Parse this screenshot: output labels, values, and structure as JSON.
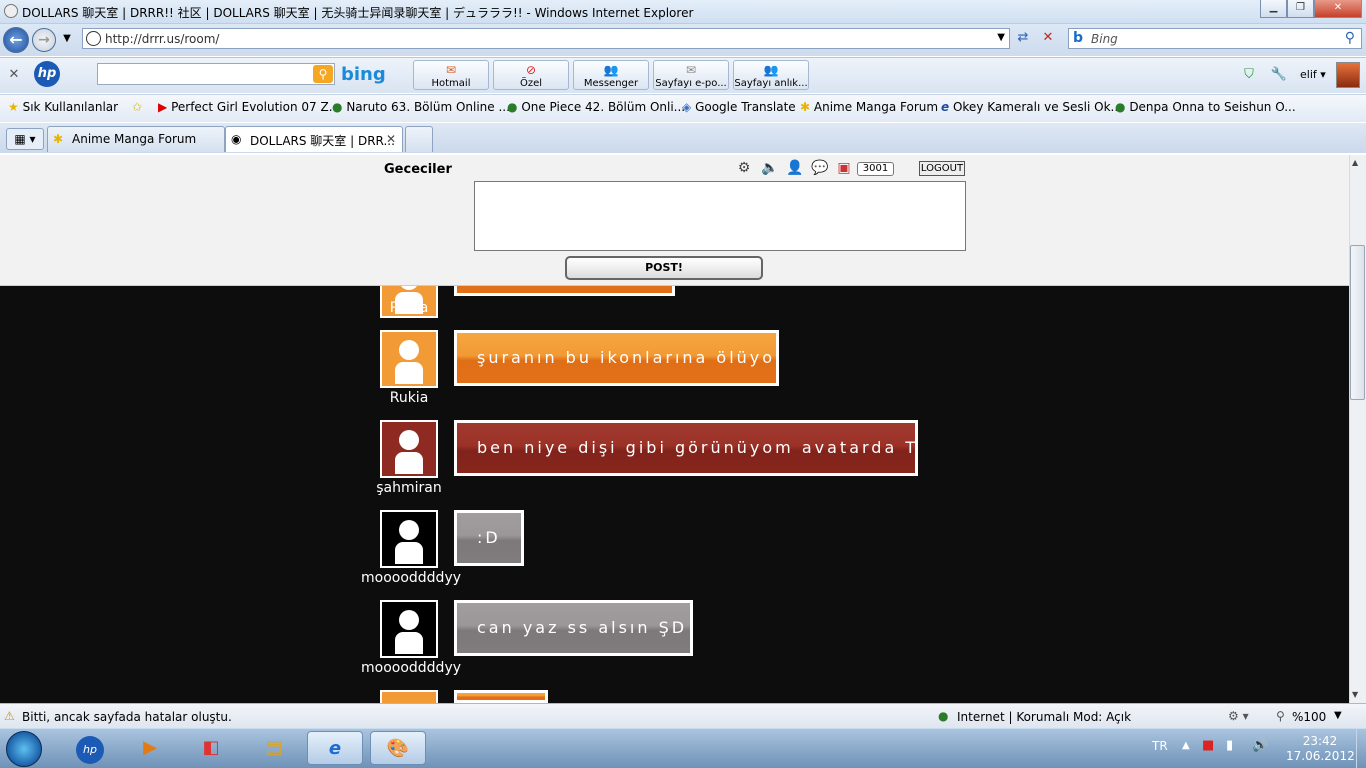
{
  "window": {
    "title": "DOLLARS 聊天室 | DRRR!! 社区 | DOLLARS 聊天室 | 无头骑士异闻录聊天室 | デュラララ!! - Windows Internet Explorer"
  },
  "address": {
    "url": "http://drrr.us/room/"
  },
  "search": {
    "placeholder": "Bing"
  },
  "hp_toolbar": {
    "bing_logo": "bing",
    "buttons": [
      {
        "label": "Hotmail",
        "glyph": "✉"
      },
      {
        "label": "Özel",
        "glyph": "⊘"
      },
      {
        "label": "Messenger",
        "glyph": "👥"
      },
      {
        "label": "Sayfayı e-po...",
        "glyph": "✉"
      },
      {
        "label": "Sayfayı anlık...",
        "glyph": "👥"
      }
    ],
    "user": "elif ▾"
  },
  "favorites": [
    {
      "label": "Sık Kullanılanlar"
    },
    {
      "label": "Perfect Girl Evolution 07 Z..."
    },
    {
      "label": "Naruto 63. Bölüm Online ..."
    },
    {
      "label": "One Piece 42. Bölüm Onli..."
    },
    {
      "label": "Google Translate"
    },
    {
      "label": "Anime Manga Forum"
    },
    {
      "label": "Okey  Kameralı ve Sesli Ok..."
    },
    {
      "label": "Denpa Onna to Seishun O..."
    }
  ],
  "tabs": [
    {
      "label": "Anime Manga Forum"
    },
    {
      "label": "DOLLARS 聊天室 | DRR..."
    }
  ],
  "room": {
    "name": "Gececiler",
    "counter": "3001",
    "logout": "LOGOUT",
    "post": "POST!"
  },
  "messages": [
    {
      "user": "Rukia",
      "text": "",
      "style": "orange"
    },
    {
      "user": "Rukia",
      "text": "şuranın bu ikonlarına ölüyom",
      "style": "orange"
    },
    {
      "user": "şahmiran",
      "text": "ben niye dişi gibi görünüyom avatarda T_T",
      "style": "red"
    },
    {
      "user": "mooooddddyy",
      "text": ":D",
      "style": "gray"
    },
    {
      "user": "mooooddddyy",
      "text": "can yaz ss alsın ŞD",
      "style": "gray"
    }
  ],
  "status": {
    "left": "Bitti, ancak sayfada hatalar oluştu.",
    "zone": "Internet | Korumalı Mod: Açık",
    "zoom": "%100"
  },
  "taskbar": {
    "lang": "TR",
    "time": "23:42",
    "date": "17.06.2012"
  },
  "colors": {
    "orange": "#e27019",
    "red": "#86261d",
    "gray": "#807c7d",
    "chat_bg": "#0d0d0d"
  }
}
